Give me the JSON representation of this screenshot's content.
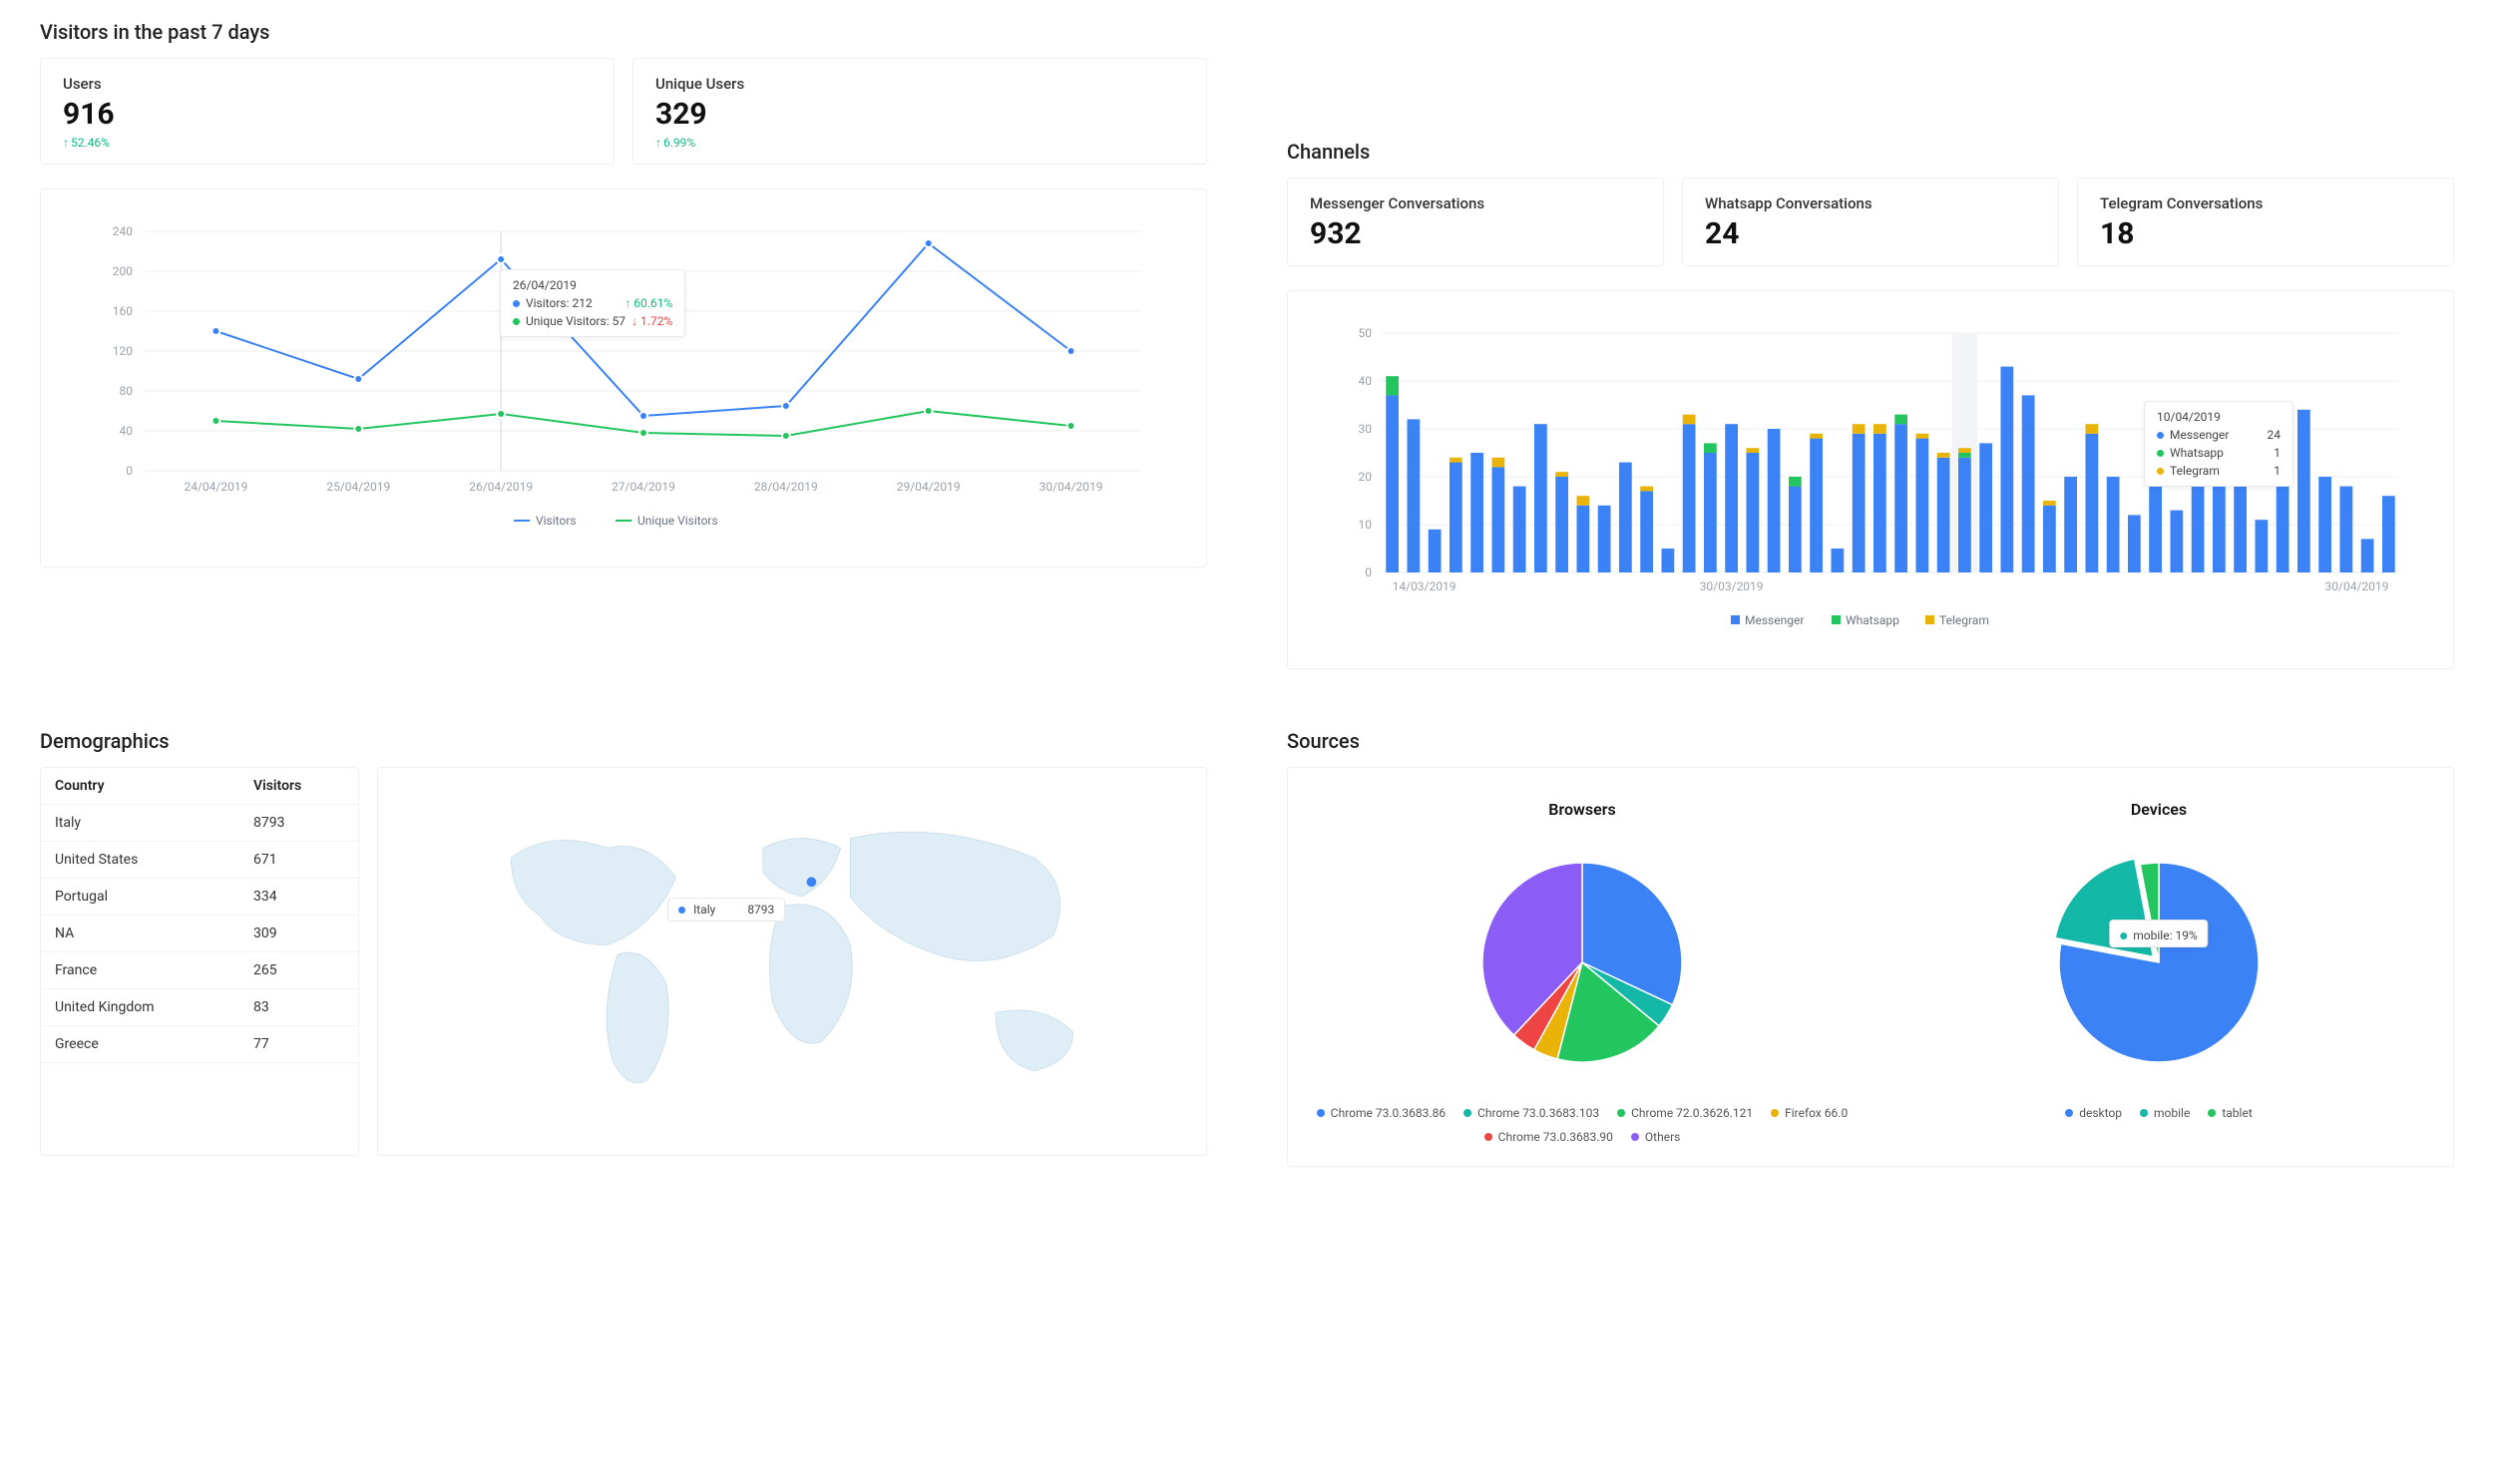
{
  "colors": {
    "blue": "#3b82f6",
    "green": "#22c55e",
    "green2": "#10b981",
    "yellow": "#eab308",
    "red": "#ef4444",
    "purple": "#8b5cf6",
    "teal": "#14b8a6"
  },
  "visitors": {
    "title": "Visitors in the past 7 days",
    "kpis": [
      {
        "label": "Users",
        "value": "916",
        "delta": "52.46%",
        "direction": "up"
      },
      {
        "label": "Unique Users",
        "value": "329",
        "delta": "6.99%",
        "direction": "up"
      }
    ],
    "tooltip": {
      "date": "26/04/2019",
      "rows": [
        {
          "color": "#3b82f6",
          "label": "Visitors: 212",
          "delta": "60.61%",
          "direction": "up"
        },
        {
          "color": "#22c55e",
          "label": "Unique Visitors: 57",
          "delta": "1.72%",
          "direction": "down"
        }
      ]
    },
    "legend": [
      "Visitors",
      "Unique Visitors"
    ]
  },
  "channels": {
    "title": "Channels",
    "kpis": [
      {
        "label": "Messenger Conversations",
        "value": "932"
      },
      {
        "label": "Whatsapp Conversations",
        "value": "24"
      },
      {
        "label": "Telegram Conversations",
        "value": "18"
      }
    ],
    "tooltip": {
      "date": "10/04/2019",
      "rows": [
        {
          "color": "#3b82f6",
          "label": "Messenger",
          "val": "24"
        },
        {
          "color": "#22c55e",
          "label": "Whatsapp",
          "val": "1"
        },
        {
          "color": "#eab308",
          "label": "Telegram",
          "val": "1"
        }
      ]
    },
    "legend": [
      "Messenger",
      "Whatsapp",
      "Telegram"
    ]
  },
  "demographics": {
    "title": "Demographics",
    "headers": [
      "Country",
      "Visitors"
    ],
    "rows": [
      [
        "Italy",
        "8793"
      ],
      [
        "United States",
        "671"
      ],
      [
        "Portugal",
        "334"
      ],
      [
        "NA",
        "309"
      ],
      [
        "France",
        "265"
      ],
      [
        "United Kingdom",
        "83"
      ],
      [
        "Greece",
        "77"
      ]
    ],
    "map_tooltip": {
      "country": "Italy",
      "value": "8793"
    }
  },
  "sources": {
    "title": "Sources",
    "browsers_title": "Browsers",
    "devices_title": "Devices",
    "devices_tooltip": "mobile: 19%",
    "browser_legend": [
      {
        "color": "#3b82f6",
        "label": "Chrome 73.0.3683.86"
      },
      {
        "color": "#14b8a6",
        "label": "Chrome 73.0.3683.103"
      },
      {
        "color": "#22c55e",
        "label": "Chrome 72.0.3626.121"
      },
      {
        "color": "#eab308",
        "label": "Firefox 66.0"
      },
      {
        "color": "#ef4444",
        "label": "Chrome 73.0.3683.90"
      },
      {
        "color": "#8b5cf6",
        "label": "Others"
      }
    ],
    "device_legend": [
      {
        "color": "#3b82f6",
        "label": "desktop"
      },
      {
        "color": "#14b8a6",
        "label": "mobile"
      },
      {
        "color": "#22c55e",
        "label": "tablet"
      }
    ]
  },
  "chart_data": [
    {
      "type": "line",
      "id": "visitors_7d",
      "title": "Visitors in the past 7 days",
      "xlabel": "",
      "ylabel": "",
      "ylim": [
        0,
        240
      ],
      "categories": [
        "24/04/2019",
        "25/04/2019",
        "26/04/2019",
        "27/04/2019",
        "28/04/2019",
        "29/04/2019",
        "30/04/2019"
      ],
      "series": [
        {
          "name": "Visitors",
          "color": "#3b82f6",
          "values": [
            140,
            92,
            212,
            55,
            65,
            228,
            120
          ]
        },
        {
          "name": "Unique Visitors",
          "color": "#22c55e",
          "values": [
            50,
            42,
            57,
            38,
            35,
            60,
            45
          ]
        }
      ]
    },
    {
      "type": "bar",
      "id": "channels_daily",
      "title": "Channel conversations per day",
      "xlabel": "",
      "ylabel": "",
      "ylim": [
        0,
        50
      ],
      "categories": [
        "14/03/2019",
        "15/03",
        "16/03",
        "17/03",
        "18/03",
        "19/03",
        "20/03",
        "21/03",
        "22/03",
        "23/03",
        "24/03",
        "25/03",
        "26/03",
        "27/03",
        "28/03",
        "29/03",
        "30/03/2019",
        "31/03",
        "01/04",
        "02/04",
        "03/04",
        "04/04",
        "05/04",
        "06/04",
        "07/04",
        "08/04",
        "09/04",
        "10/04/2019",
        "11/04",
        "12/04",
        "13/04",
        "14/04",
        "15/04",
        "16/04",
        "17/04",
        "18/04",
        "19/04",
        "20/04",
        "21/04",
        "22/04",
        "23/04",
        "24/04",
        "25/04",
        "26/04",
        "27/04",
        "28/04",
        "29/04",
        "30/04/2019"
      ],
      "series": [
        {
          "name": "Messenger",
          "color": "#3b82f6",
          "values": [
            37,
            32,
            9,
            23,
            25,
            22,
            18,
            31,
            20,
            14,
            14,
            23,
            17,
            5,
            31,
            25,
            31,
            25,
            30,
            18,
            28,
            5,
            29,
            29,
            31,
            28,
            24,
            24,
            27,
            43,
            37,
            14,
            20,
            29,
            20,
            12,
            23,
            13,
            25,
            28,
            24,
            11,
            20,
            34,
            20,
            18,
            7,
            16
          ]
        },
        {
          "name": "Whatsapp",
          "color": "#22c55e",
          "values": [
            4,
            0,
            0,
            0,
            0,
            0,
            0,
            0,
            0,
            0,
            0,
            0,
            0,
            0,
            0,
            2,
            0,
            0,
            0,
            2,
            0,
            0,
            0,
            0,
            2,
            0,
            0,
            1,
            0,
            0,
            0,
            0,
            0,
            0,
            0,
            0,
            0,
            0,
            0,
            0,
            0,
            0,
            0,
            0,
            0,
            0,
            0,
            0
          ]
        },
        {
          "name": "Telegram",
          "color": "#eab308",
          "values": [
            0,
            0,
            0,
            1,
            0,
            2,
            0,
            0,
            1,
            2,
            0,
            0,
            1,
            0,
            2,
            0,
            0,
            1,
            0,
            0,
            1,
            0,
            2,
            2,
            0,
            1,
            1,
            1,
            0,
            0,
            0,
            1,
            0,
            2,
            0,
            0,
            0,
            0,
            0,
            0,
            1,
            0,
            0,
            0,
            0,
            0,
            0,
            0
          ]
        }
      ],
      "x_ticks": [
        "14/03/2019",
        "30/03/2019",
        "30/04/2019"
      ]
    },
    {
      "type": "pie",
      "id": "browsers",
      "title": "Browsers",
      "slices": [
        {
          "name": "Chrome 73.0.3683.86",
          "value": 32,
          "color": "#3b82f6"
        },
        {
          "name": "Chrome 73.0.3683.103",
          "value": 4,
          "color": "#14b8a6"
        },
        {
          "name": "Chrome 72.0.3626.121",
          "value": 18,
          "color": "#22c55e"
        },
        {
          "name": "Firefox 66.0",
          "value": 4,
          "color": "#eab308"
        },
        {
          "name": "Chrome 73.0.3683.90",
          "value": 4,
          "color": "#ef4444"
        },
        {
          "name": "Others",
          "value": 38,
          "color": "#8b5cf6"
        }
      ]
    },
    {
      "type": "pie",
      "id": "devices",
      "title": "Devices",
      "slices": [
        {
          "name": "desktop",
          "value": 78,
          "color": "#3b82f6"
        },
        {
          "name": "mobile",
          "value": 19,
          "color": "#14b8a6"
        },
        {
          "name": "tablet",
          "value": 3,
          "color": "#22c55e"
        }
      ]
    },
    {
      "type": "table",
      "id": "demographics",
      "columns": [
        "Country",
        "Visitors"
      ],
      "rows": [
        [
          "Italy",
          8793
        ],
        [
          "United States",
          671
        ],
        [
          "Portugal",
          334
        ],
        [
          "NA",
          309
        ],
        [
          "France",
          265
        ],
        [
          "United Kingdom",
          83
        ],
        [
          "Greece",
          77
        ]
      ]
    }
  ]
}
